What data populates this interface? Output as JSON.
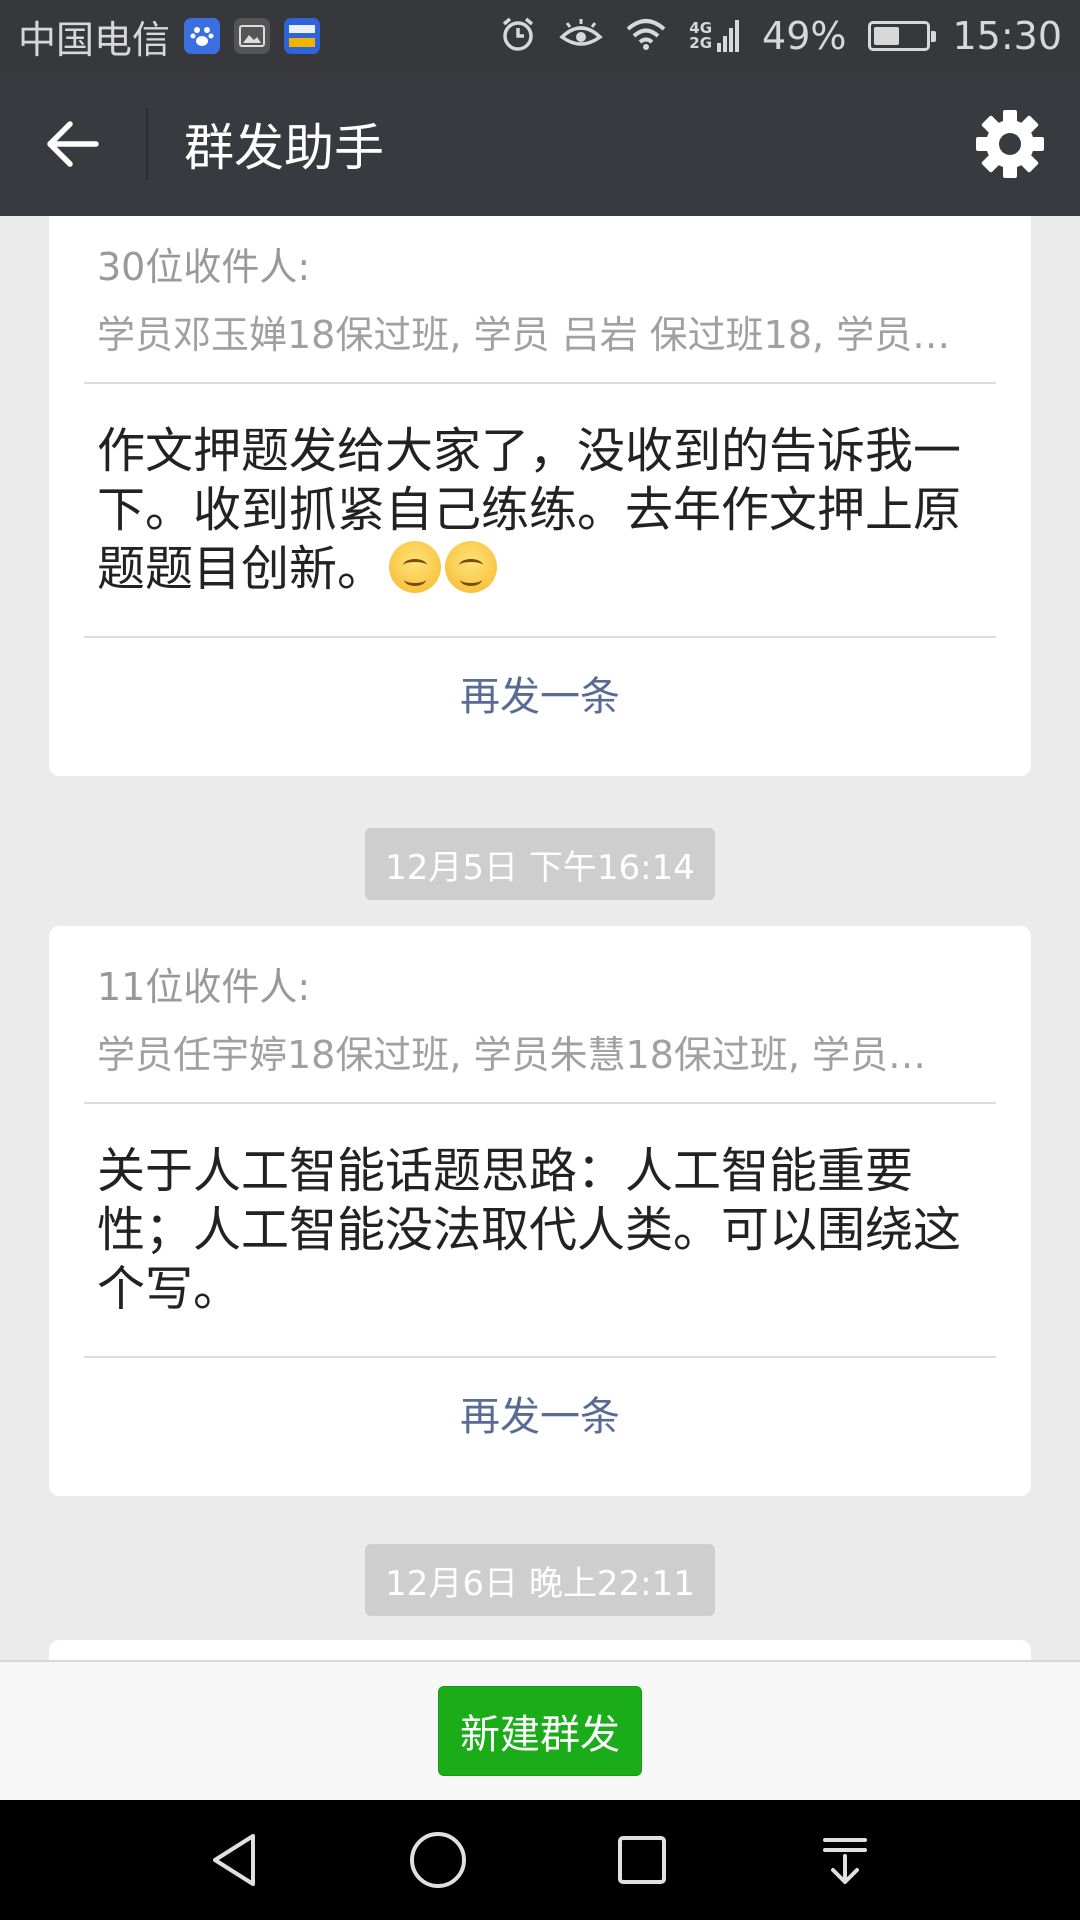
{
  "status_bar": {
    "carrier": "中国电信",
    "app_icons": [
      "baidu-app-icon",
      "gallery-app-icon",
      "autohome-app-icon"
    ],
    "network": [
      "4G",
      "2G"
    ],
    "battery_percent": "49%",
    "battery_level": 0.49,
    "time": "15:30"
  },
  "header": {
    "title": "群发助手"
  },
  "cards": [
    {
      "recipients_count": "30位收件人:",
      "recipients": "学员邓玉婵18保过班, 学员 吕岩 保过班18, 学员…",
      "message": "作文押题发给大家了，没收到的告诉我一下。收到抓紧自己练练。去年作文押上原题题目创新。",
      "emoji_count": 2,
      "resend_label": "再发一条"
    },
    {
      "recipients_count": "11位收件人:",
      "recipients": "学员任宇婷18保过班, 学员朱慧18保过班, 学员…",
      "message": "关于人工智能话题思路：人工智能重要性；人工智能没法取代人类。可以围绕这个写。",
      "resend_label": "再发一条"
    }
  ],
  "timestamps": [
    "12月5日 下午16:14",
    "12月6日 晚上22:11"
  ],
  "bottom": {
    "new_broadcast_label": "新建群发"
  },
  "colors": {
    "title_bar": "#393a3f",
    "status_bar": "#37383c",
    "link": "#576b95",
    "primary_button": "#1aad19",
    "background": "#ebebeb"
  }
}
